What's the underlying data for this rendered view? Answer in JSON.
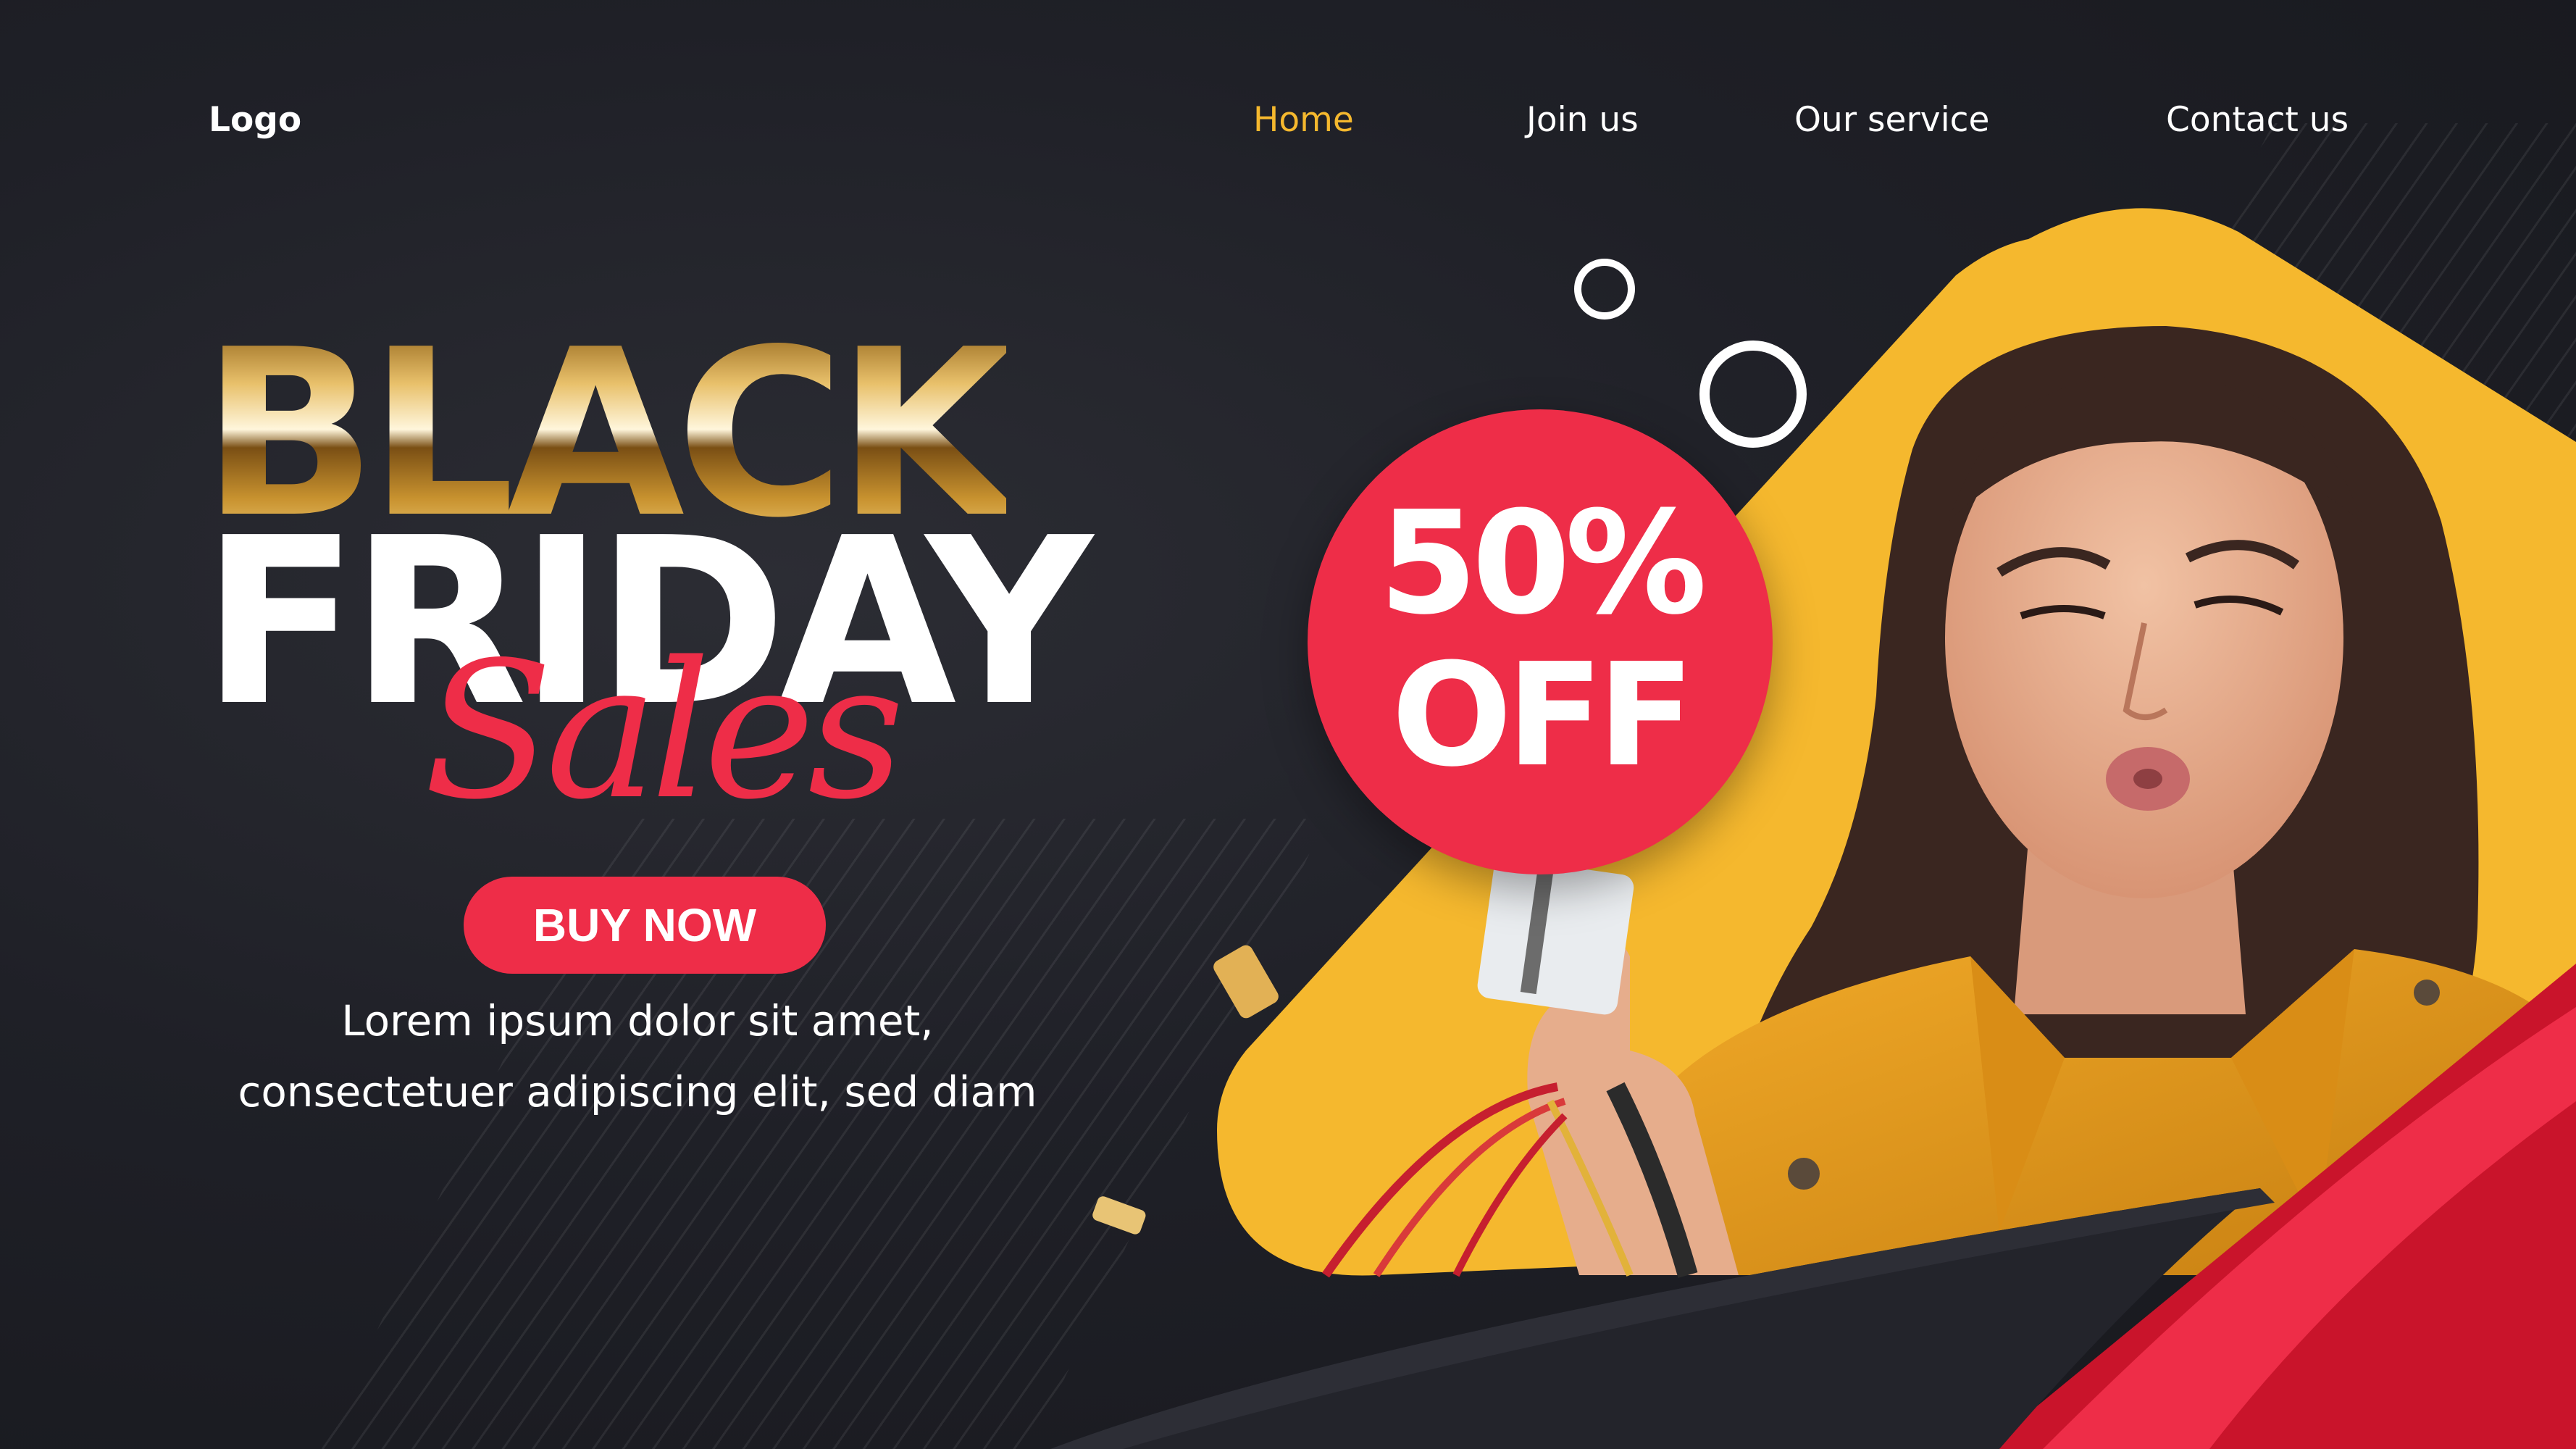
{
  "nav": {
    "logo": "Logo",
    "items": [
      {
        "label": "Home",
        "active": true
      },
      {
        "label": "Join us",
        "active": false
      },
      {
        "label": "Our service",
        "active": false
      },
      {
        "label": "Contact us",
        "active": false
      }
    ]
  },
  "hero": {
    "headline_line1": "BLACK",
    "headline_line2": "FRIDAY",
    "headline_script": "Sales",
    "cta_label": "BUY NOW",
    "description_line1": "Lorem ipsum dolor sit amet,",
    "description_line2": "consectetuer adipiscing elit, sed diam"
  },
  "badge": {
    "line1": "50%",
    "line2": "OFF"
  },
  "colors": {
    "background": "#1f2027",
    "accent_red": "#ee2d48",
    "accent_yellow": "#f5b82e",
    "nav_active": "#f5b82e",
    "text": "#ffffff"
  },
  "icons": {
    "ring_small": "circle-outline-icon",
    "ring_large": "circle-outline-icon"
  }
}
